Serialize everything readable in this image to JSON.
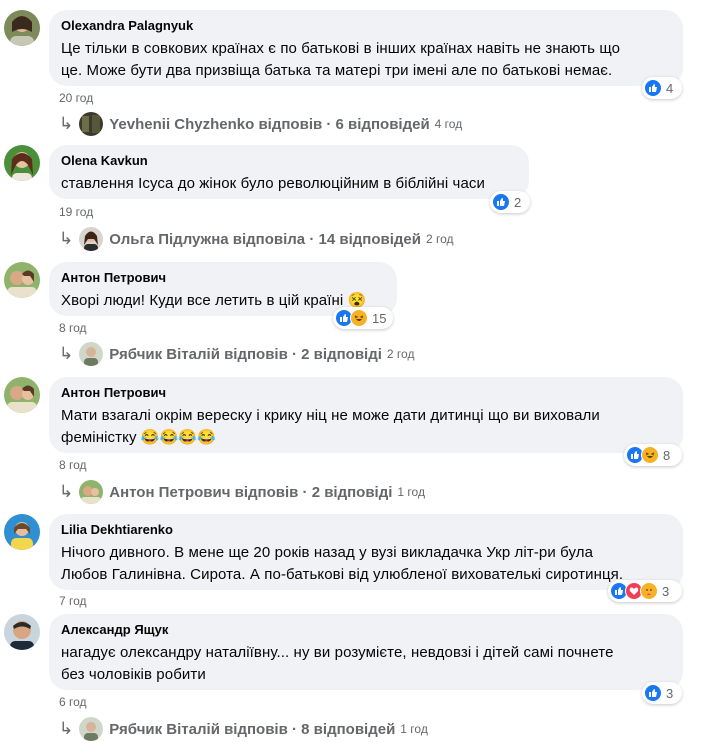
{
  "colors": {
    "like": "#1877f2",
    "love": "#f33e58",
    "haha": "#f7b125",
    "muted": "#65676b",
    "bubble": "#f0f2f5"
  },
  "comments": [
    {
      "author": "Olexandra Palagnyuk",
      "lines": [
        "Це тільки в совкових країнах є по батькові в інших країнах навіть не знають що",
        "це. Може бути два призвіща батька та матері три імені але по батькові немає."
      ],
      "time": "20 год",
      "reactions": [
        "like-icon"
      ],
      "count": "4",
      "reply": {
        "text": "Yevhenii Chyzhenko відповів",
        "sep": " · ",
        "count": "6 відповідей",
        "time": "4 год"
      }
    },
    {
      "author": "Olena Kavkun",
      "lines": [
        "ставлення Ісуса до жінок було революційним в біблійні часи"
      ],
      "time": "19 год",
      "reactions": [
        "like-icon"
      ],
      "count": "2",
      "reply": {
        "text": "Ольга Підлужна відповіла",
        "sep": " · ",
        "count": "14 відповідей",
        "time": "2 год"
      }
    },
    {
      "author": "Антон Петрович",
      "lines": [
        "Хворі люди! Куди все летить в цій країні 😵"
      ],
      "time": "8 год",
      "reactions": [
        "like-icon",
        "haha-icon"
      ],
      "count": "15",
      "reply": {
        "text": "Рябчик Віталій відповів",
        "sep": " · ",
        "count": "2 відповіді",
        "time": "2 год"
      }
    },
    {
      "author": "Антон Петрович",
      "lines": [
        "Мати взагалі окрім вереску і крику ніц не може дати дитинці що ви виховали",
        "феміністку 😂😂😂😂"
      ],
      "time": "8 год",
      "reactions": [
        "like-icon",
        "haha-icon"
      ],
      "count": "8",
      "reply": {
        "text": "Антон Петрович відповів",
        "sep": " · ",
        "count": "2 відповіді",
        "time": "1 год"
      }
    },
    {
      "author": "Lilia Dekhtiarenko",
      "lines": [
        "Нічого дивного. В мене ще 20 років назад у вузі викладачка Укр літ-ри була",
        "Любов Галинівна. Сирота. А по-батькові від улюбленої вихователькі сиротинця."
      ],
      "time": "7 год",
      "reactions": [
        "like-icon",
        "love-icon",
        "care-icon"
      ],
      "count": "3",
      "reply": null
    },
    {
      "author": "Александр Ящук",
      "lines": [
        "нагадує олександру наталіївну... ну ви розумієте, невдовзі і дітей самі почнете",
        "без чоловіків робити"
      ],
      "time": "6 год",
      "reactions": [
        "like-icon"
      ],
      "count": "3",
      "reply": {
        "text": "Рябчик Віталій відповів",
        "sep": " · ",
        "count": "8 відповідей",
        "time": "1 год"
      }
    }
  ]
}
